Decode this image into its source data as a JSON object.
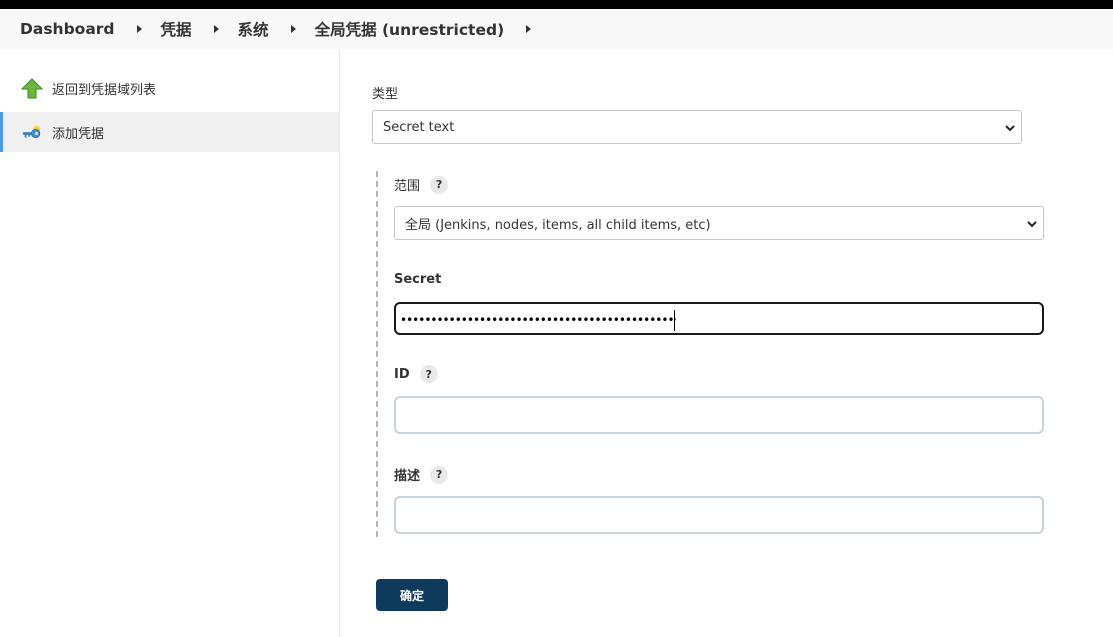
{
  "breadcrumb": {
    "items": [
      "Dashboard",
      "凭据",
      "系统",
      "全局凭据 (unrestricted)"
    ]
  },
  "sidebar": {
    "items": [
      {
        "label": "返回到凭据域列表",
        "icon": "up-arrow-icon",
        "active": false
      },
      {
        "label": "添加凭据",
        "icon": "key-icon",
        "active": true
      }
    ]
  },
  "form": {
    "kind_label": "类型",
    "kind_value": "Secret text",
    "scope_label": "范围",
    "scope_value": "全局 (Jenkins, nodes, items, all child items, etc)",
    "secret_label": "Secret",
    "secret_value": "••••••••••••••••••••••••••••••••••••••••••••••••••••••••",
    "id_label": "ID",
    "id_value": "",
    "description_label": "描述",
    "description_value": "",
    "help_glyph": "?",
    "submit_label": "确定"
  },
  "colors": {
    "accent": "#4d9bdc",
    "button": "#0e3a5c",
    "topbar": "#000000",
    "breadcrumb_bg": "#f8f8f8"
  }
}
